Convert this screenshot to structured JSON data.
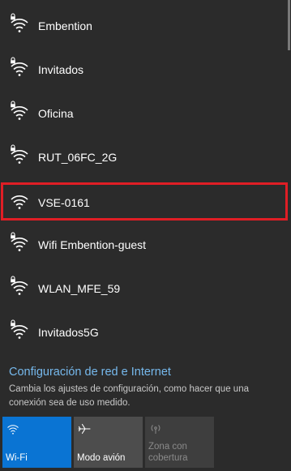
{
  "networks": [
    {
      "ssid": "Embention",
      "icon": "wifi-secured-icon",
      "highlighted": false
    },
    {
      "ssid": "Invitados",
      "icon": "wifi-secured-icon",
      "highlighted": false
    },
    {
      "ssid": "Oficina",
      "icon": "wifi-secured-icon",
      "highlighted": false
    },
    {
      "ssid": "RUT_06FC_2G",
      "icon": "wifi-secured-icon",
      "highlighted": false
    },
    {
      "ssid": "VSE-0161",
      "icon": "wifi-open-icon",
      "highlighted": true
    },
    {
      "ssid": "Wifi Embention-guest",
      "icon": "wifi-secured-icon",
      "highlighted": false
    },
    {
      "ssid": "WLAN_MFE_59",
      "icon": "wifi-secured-icon",
      "highlighted": false
    },
    {
      "ssid": "Invitados5G",
      "icon": "wifi-secured-icon",
      "highlighted": false
    }
  ],
  "settings": {
    "link_text": "Configuración de red e Internet",
    "description": "Cambia los ajustes de configuración, como hacer que una conexión sea de uso medido."
  },
  "quick_actions": [
    {
      "label": "Wi-Fi",
      "icon": "wifi-icon",
      "state": "active"
    },
    {
      "label": "Modo avión",
      "icon": "airplane-icon",
      "state": "normal"
    },
    {
      "label": "Zona con cobertura",
      "icon": "mobile-hotspot-icon",
      "state": "disabled"
    }
  ],
  "colors": {
    "background": "#2b2b2b",
    "accent": "#0a74d3",
    "link": "#76b9ed",
    "highlight_border": "#e01e25"
  }
}
